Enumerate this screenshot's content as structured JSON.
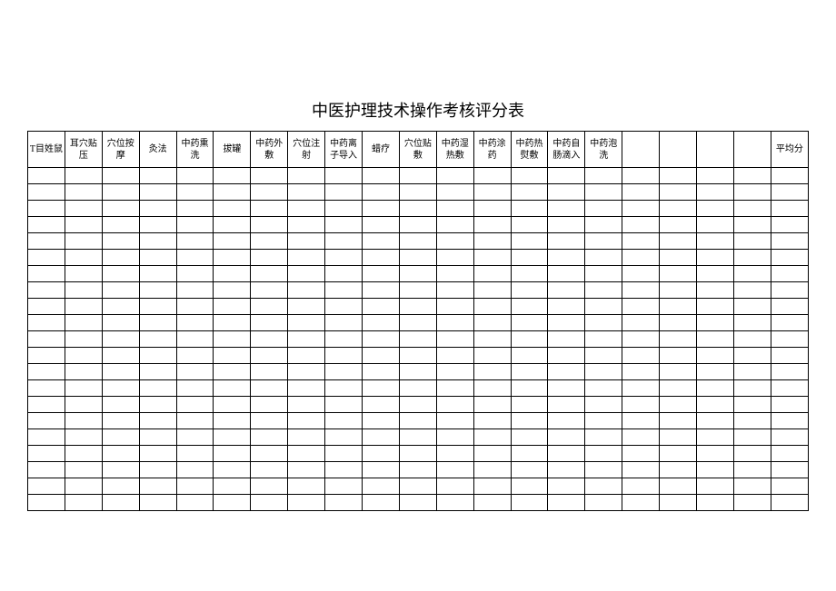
{
  "title": "中医护理技术操作考核评分表",
  "headers": [
    "T目姓鼠",
    "耳穴贴压",
    "穴位按摩",
    "灸法",
    "中药熏洗",
    "拔罐",
    "中药外敷",
    "穴位注射",
    "中药离子导入",
    "蜡疗",
    "穴位贴敷",
    "中药湿热敷",
    "中药涂药",
    "中药热熨敷",
    "中药自肠滴入",
    "中药泡洗",
    "",
    "",
    "",
    "",
    "平均分"
  ],
  "rowCount": 21,
  "colCount": 21
}
